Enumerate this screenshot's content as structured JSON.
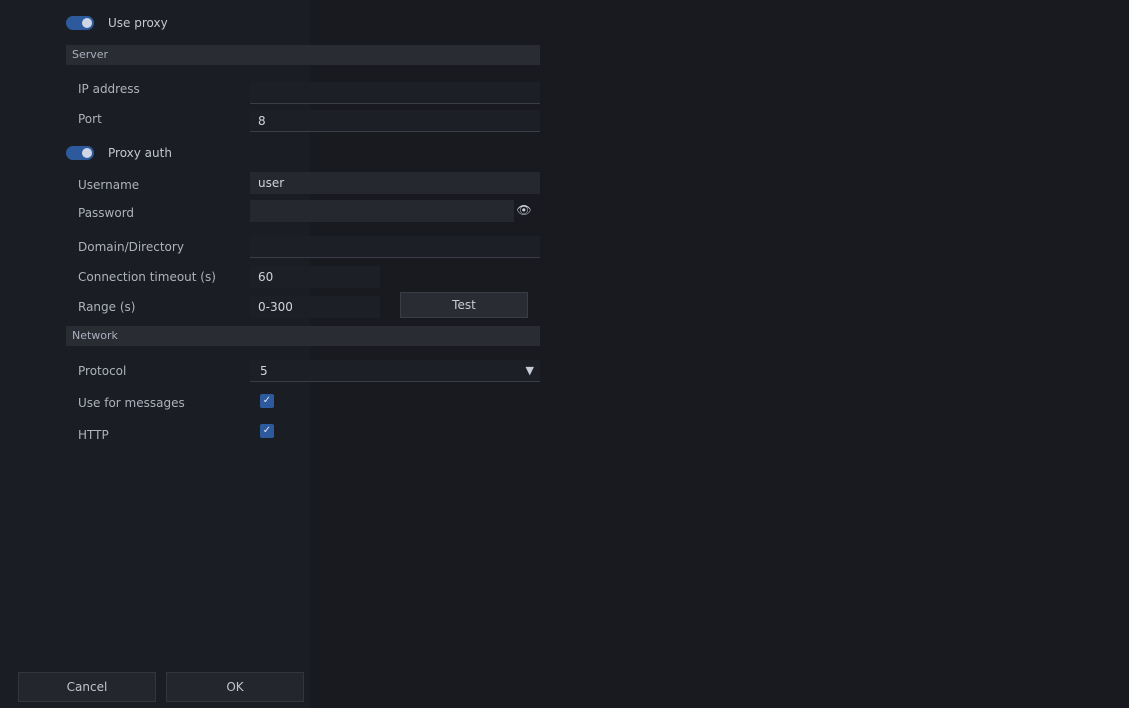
{
  "toggles": {
    "proxy_label": "Use proxy",
    "auth_label": "Proxy auth"
  },
  "sections": {
    "server": "Server",
    "network": "Network"
  },
  "fields": {
    "ip_address_label": "IP address",
    "ip_address_value": "",
    "port_label": "Port",
    "port_value": "8",
    "username_label": "Username",
    "username_value": "user",
    "password_label": "Password",
    "password_value": "",
    "domain_label": "Domain/Directory",
    "domain_value": "",
    "conn_timeout_label": "Connection timeout (s)",
    "conn_timeout_value": "60",
    "range_label": "Range (s)",
    "range_value": "0-300",
    "test_button": "Test"
  },
  "network": {
    "protocol_label": "Protocol",
    "protocol_value": "5",
    "use_for_messages_label": "Use for messages",
    "http_label": "HTTP"
  },
  "footer": {
    "cancel": "Cancel",
    "ok": "OK"
  },
  "colors": {
    "accent": "#2d5a9c",
    "background": "#181a20"
  }
}
